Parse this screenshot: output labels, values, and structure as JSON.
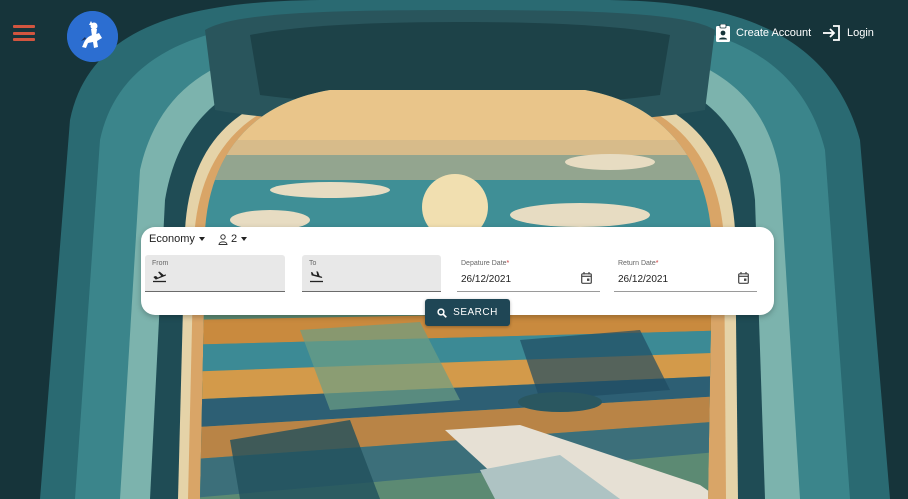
{
  "header": {
    "menu_icon": "menu-icon",
    "logo_icon": "rider-logo-icon",
    "create_account_label": "Create Account",
    "login_label": "Login"
  },
  "search_form": {
    "cabin_class": "Economy",
    "passengers": "2",
    "from": {
      "label": "From",
      "value": ""
    },
    "to": {
      "label": "To",
      "value": ""
    },
    "departure": {
      "label": "Depature Date",
      "required_mark": "*",
      "value": "26/12/2021"
    },
    "return": {
      "label": "Return Date",
      "required_mark": "*",
      "value": "26/12/2021"
    },
    "search_label": "SEARCH"
  },
  "colors": {
    "menu": "#d2553f",
    "logo_bg": "#2c6ed1",
    "search_button": "#1f4655",
    "sky": "#3f8f96",
    "frame_dark": "#16343a"
  }
}
